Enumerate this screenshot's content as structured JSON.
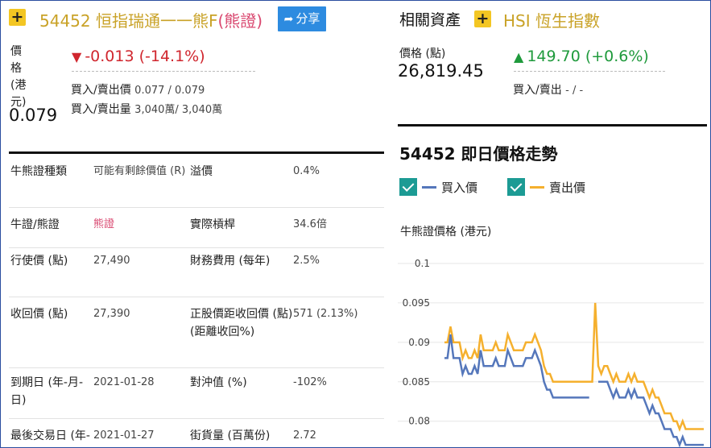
{
  "left": {
    "code": "54452",
    "name": "恒指瑞通一一熊F",
    "name_suffix": "(熊證)",
    "share": "分享",
    "price_label": "價格(港元)",
    "price": "0.079",
    "change": "-0.013 (-14.1%)",
    "bid_ask_label": "買入/賣出價",
    "bid_ask_value": "0.077 / 0.079",
    "bid_ask_vol_label": "買入/賣出量",
    "bid_ask_vol_value": "3,040萬/ 3,040萬",
    "rows": [
      {
        "l1": "牛熊證種類",
        "v1": "可能有剩餘價值 (R)",
        "l2": "溢價",
        "v2": "0.4%"
      },
      {
        "l1": "牛證/熊證",
        "v1": "熊證",
        "l2": "實際槓桿",
        "v2": "34.6倍"
      },
      {
        "l1": "行使價 (點)",
        "v1": "27,490",
        "l2": "財務費用 (每年)",
        "v2": "2.5%"
      },
      {
        "l1": "收回價 (點)",
        "v1": "27,390",
        "l2": "正股價距收回價 (點) (距離收回%)",
        "v2": "571 (2.13%)"
      },
      {
        "l1": "到期日 (年-月-日)",
        "v1": "2021-01-28",
        "l2": "對沖值 (%)",
        "v2": "-102%"
      },
      {
        "l1": "最後交易日 (年-月-日)",
        "v1": "2021-01-27",
        "l2": "街貨量 (百萬份)",
        "v2": "2.72"
      }
    ]
  },
  "right": {
    "related_title": "相關資產",
    "hsi_title": "HSI 恆生指數",
    "index_label": "價格 (點)",
    "index_value": "26,819.45",
    "index_change": "149.70 (+0.6%)",
    "index_bid_ask_label": "買入/賣出",
    "index_bid_ask_value": "- / -",
    "chart_title": "54452 即日價格走勢",
    "legend_bid": "買入價",
    "legend_ask": "賣出價",
    "y_title": "牛熊證價格 (港元)"
  },
  "colors": {
    "accent": "#f3c623",
    "title_gold": "#c9a227",
    "bear_pink": "#d9476f",
    "down_red": "#d0262e",
    "up_green": "#1f9a3c",
    "share_blue": "#2d8be0",
    "checkbox_teal": "#1c9b94",
    "bid_line": "#5577bb",
    "ask_line": "#f5b02e"
  },
  "icons": {
    "add": "plus-icon",
    "share": "share-arrow-icon",
    "down": "triangle-down-icon",
    "up": "triangle-up-icon",
    "check": "checkbox-checked-icon"
  },
  "chart_data": {
    "type": "line",
    "title": "54452 即日價格走勢",
    "ylabel": "牛熊證價格 (港元)",
    "xlabel": "",
    "ylim": [
      0.0765,
      0.1
    ],
    "yticks": [
      0.08,
      0.085,
      0.09,
      0.095,
      0.1
    ],
    "grid": true,
    "legend": "top-left",
    "series": [
      {
        "name": "賣出價",
        "color": "#f5b02e",
        "values": [
          0.09,
          0.09,
          0.092,
          0.09,
          0.09,
          0.09,
          0.088,
          0.089,
          0.088,
          0.088,
          0.089,
          0.088,
          0.091,
          0.089,
          0.089,
          0.089,
          0.089,
          0.09,
          0.089,
          0.089,
          0.089,
          0.091,
          0.09,
          0.089,
          0.089,
          0.089,
          0.089,
          0.09,
          0.09,
          0.09,
          0.091,
          0.09,
          0.089,
          0.087,
          0.086,
          0.086,
          0.085,
          0.085,
          0.085,
          0.085,
          0.085,
          0.085,
          0.085,
          0.085,
          0.085,
          0.085,
          0.085,
          0.085,
          0.085,
          0.085,
          0.095,
          0.087,
          0.086,
          0.087,
          0.087,
          0.086,
          0.085,
          0.086,
          0.085,
          0.085,
          0.085,
          0.086,
          0.085,
          0.086,
          0.085,
          0.085,
          0.085,
          0.084,
          0.083,
          0.084,
          0.083,
          0.083,
          0.082,
          0.081,
          0.081,
          0.081,
          0.08,
          0.08,
          0.079,
          0.08,
          0.079,
          0.079,
          0.079,
          0.079,
          0.079,
          0.079,
          0.079
        ]
      },
      {
        "name": "買入價",
        "color": "#5577bb",
        "values": [
          0.088,
          0.088,
          0.091,
          0.088,
          0.088,
          0.088,
          0.086,
          0.087,
          0.086,
          0.086,
          0.087,
          0.086,
          0.089,
          0.087,
          0.087,
          0.087,
          0.087,
          0.088,
          0.087,
          0.087,
          0.087,
          0.089,
          0.088,
          0.087,
          0.087,
          0.087,
          0.087,
          0.088,
          0.088,
          0.088,
          0.089,
          0.088,
          0.087,
          0.085,
          0.084,
          0.084,
          0.083,
          0.083,
          0.083,
          0.083,
          0.083,
          0.083,
          0.083,
          0.083,
          0.083,
          0.083,
          0.083,
          0.083,
          0.083,
          null,
          null,
          0.085,
          0.085,
          0.085,
          0.085,
          0.084,
          0.083,
          0.084,
          0.083,
          0.083,
          0.083,
          0.084,
          0.083,
          0.084,
          0.083,
          0.083,
          0.083,
          0.082,
          0.081,
          0.082,
          0.081,
          0.081,
          0.08,
          0.079,
          0.079,
          0.079,
          0.078,
          0.078,
          0.077,
          0.078,
          0.077,
          0.077,
          0.077,
          0.077,
          0.077,
          0.077,
          0.077
        ]
      }
    ]
  }
}
